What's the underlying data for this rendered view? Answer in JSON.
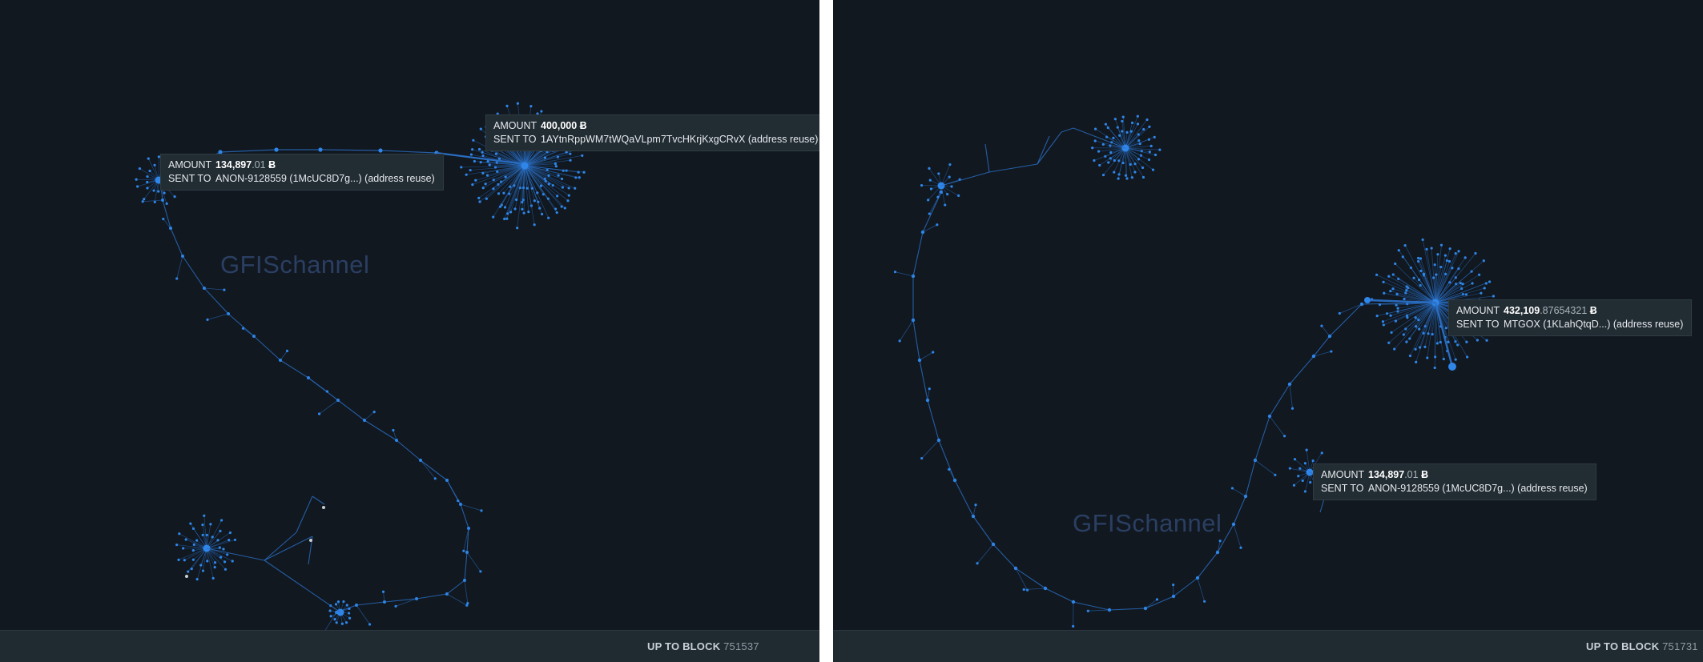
{
  "panels": {
    "left": {
      "watermark": "GFISchannel",
      "footer": {
        "label": "UP TO BLOCK",
        "block": "751537"
      },
      "tooltips": [
        {
          "amount_label": "AMOUNT",
          "amount_int": "400,000",
          "amount_dec": "",
          "currency": "Ƀ",
          "sent_label": "SENT TO",
          "sent_to": "1AYtnRppWM7tWQaVLpm7TvcHKrjKxgCRvX (address reuse)"
        },
        {
          "amount_label": "AMOUNT",
          "amount_int": "134,897",
          "amount_dec": ".01",
          "currency": "Ƀ",
          "sent_label": "SENT TO",
          "sent_to": "ANON-9128559 (1McUC8D7g...) (address reuse)"
        }
      ]
    },
    "right": {
      "watermark": "GFISchannel",
      "footer": {
        "label": "UP TO BLOCK",
        "block": "751731"
      },
      "tooltips": [
        {
          "amount_label": "AMOUNT",
          "amount_int": "432,109",
          "amount_dec": ".87654321",
          "currency": "Ƀ",
          "sent_label": "SENT TO",
          "sent_to": "MTGOX (1KLahQtqD...) (address reuse)"
        },
        {
          "amount_label": "AMOUNT",
          "amount_int": "134,897",
          "amount_dec": ".01",
          "currency": "Ƀ",
          "sent_label": "SENT TO",
          "sent_to": "ANON-9128559 (1McUC8D7g...) (address reuse)"
        }
      ]
    }
  },
  "colors": {
    "background": "#111820",
    "node": "#2f86e8",
    "edge": "#2a6fc4",
    "watermark": "#2b3f63",
    "tooltip_bg": "#222c33",
    "footer_bg": "#202a31"
  }
}
